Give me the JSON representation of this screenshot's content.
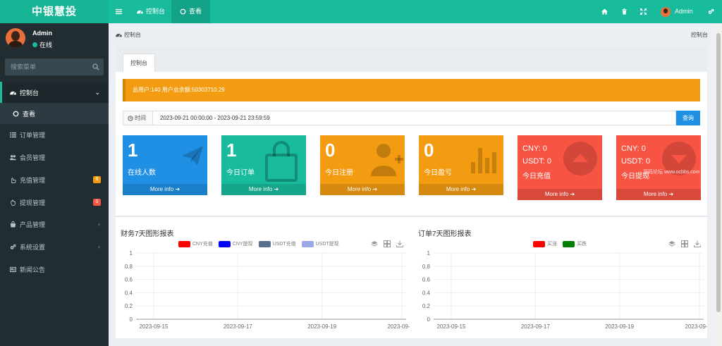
{
  "brand": "中银慧投",
  "topbar": {
    "menu_toggle": "≡",
    "tabs": [
      {
        "label": "控制台"
      },
      {
        "label": "查看"
      }
    ],
    "user_name": "Admin"
  },
  "sidebar": {
    "user_name": "Admin",
    "status": "在线",
    "search_placeholder": "搜索菜单",
    "items": [
      {
        "label": "控制台"
      },
      {
        "label": "查看"
      },
      {
        "label": "订单管理"
      },
      {
        "label": "会员管理"
      },
      {
        "label": "充值管理",
        "badge": "6"
      },
      {
        "label": "提现管理",
        "badge": "0"
      },
      {
        "label": "产品管理"
      },
      {
        "label": "系统设置"
      },
      {
        "label": "新闻公告"
      }
    ]
  },
  "breadcrumb": {
    "left": "控制台",
    "right": "控制台"
  },
  "tab": "控制台",
  "alert": "总用户:140    用户总余额:50303710.29",
  "time_filter": {
    "label": "时间",
    "value": "2023-09-21 00:00:00 - 2023-09-21 23:59:59",
    "button": "查询"
  },
  "cards": [
    {
      "value": "1",
      "label": "在线人数",
      "footer": "More info",
      "color": "#1f90e4"
    },
    {
      "value": "1",
      "label": "今日订单",
      "footer": "More info",
      "color": "#18bc9c"
    },
    {
      "value": "0",
      "label": "今日注册",
      "footer": "More info",
      "color": "#f39c12"
    },
    {
      "value": "0",
      "label": "今日盈亏",
      "footer": "More info",
      "color": "#f39c12"
    },
    {
      "cny": "CNY:  0",
      "usdt": "USDT:  0",
      "label": "今日充值",
      "footer": "More info",
      "color": "#f75444"
    },
    {
      "cny": "CNY:  0",
      "usdt": "USDT:  0",
      "label": "今日提现",
      "footer": "More info",
      "color": "#f75444"
    }
  ],
  "watermark": "源码论坛 www.ocbbs.com",
  "chart_data": [
    {
      "type": "line",
      "title": "财务7天图形报表",
      "x": [
        "2023-09-15",
        "2023-09-17",
        "2023-09-19",
        "2023-09-21"
      ],
      "yticks": [
        "1",
        "0.8",
        "0.6",
        "0.4",
        "0.2",
        "0"
      ],
      "ylim": [
        0,
        1
      ],
      "series": [
        {
          "name": "CNY充值",
          "color": "#ff0000",
          "values": []
        },
        {
          "name": "CNY提现",
          "color": "#0000ff",
          "values": []
        },
        {
          "name": "USDT充值",
          "color": "#5a6e90",
          "values": []
        },
        {
          "name": "USDT提现",
          "color": "#9aa8e8",
          "values": []
        }
      ],
      "grid": true,
      "legend": "top-center"
    },
    {
      "type": "line",
      "title": "订单7天图形报表",
      "x": [
        "2023-09-15",
        "2023-09-17",
        "2023-09-19",
        "2023-09-21"
      ],
      "yticks": [
        "1",
        "0.8",
        "0.6",
        "0.4",
        "0.2",
        "0"
      ],
      "ylim": [
        0,
        1
      ],
      "series": [
        {
          "name": "买涨",
          "color": "#ff0000",
          "values": []
        },
        {
          "name": "买跌",
          "color": "#008000",
          "values": []
        }
      ],
      "grid": true,
      "legend": "top-center"
    }
  ]
}
